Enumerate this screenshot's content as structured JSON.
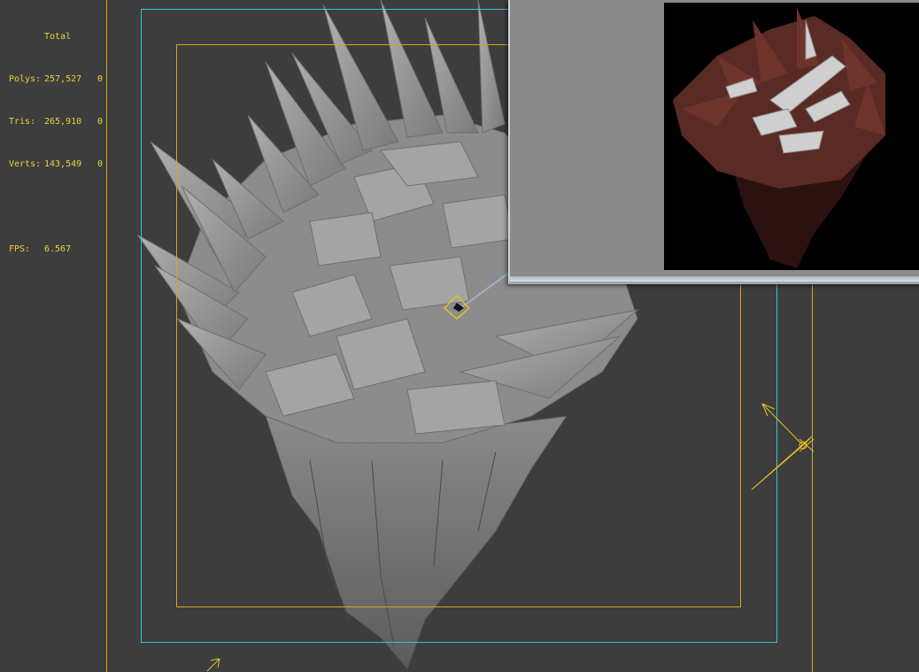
{
  "stats": {
    "header": "Total",
    "rows": [
      {
        "label": "Polys:",
        "value": "257,527",
        "sel": "0"
      },
      {
        "label": "Tris:",
        "value": "265,910",
        "sel": "0"
      },
      {
        "label": "Verts:",
        "value": "143,549",
        "sel": "0"
      }
    ],
    "fps_label": "FPS:",
    "fps_value": "6.567"
  },
  "colors": {
    "background": "#3d3d3d",
    "stats_text": "#e8d23a",
    "safe_frame_yellow": "#d6a51f",
    "safe_frame_cyan": "#36c4d0",
    "mesh": "#9a9a9a",
    "render_rock": "#5a2a24",
    "render_wood": "#cfcfcf"
  }
}
